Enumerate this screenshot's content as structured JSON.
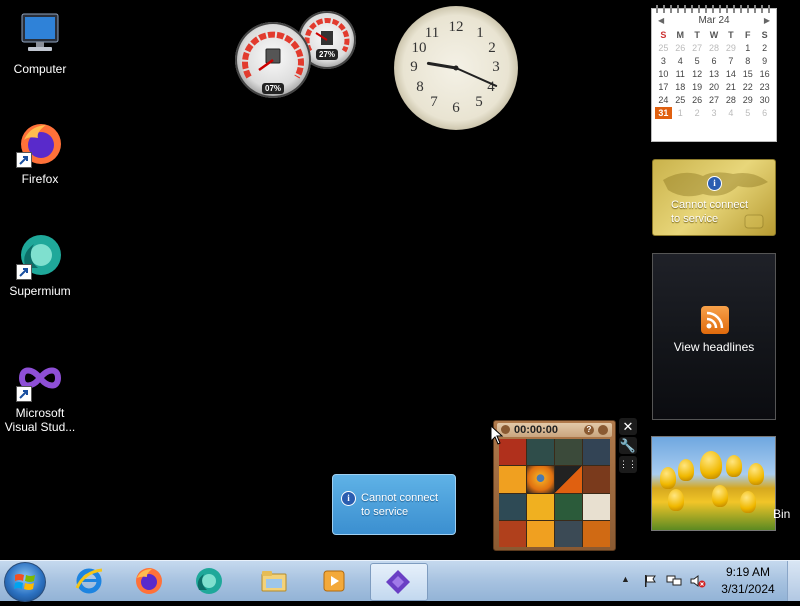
{
  "desktop": {
    "icons": [
      {
        "label": "Computer",
        "icon": "computer-icon"
      },
      {
        "label": "Firefox",
        "icon": "firefox-icon"
      },
      {
        "label": "Supermium",
        "icon": "supermium-icon"
      },
      {
        "label": "Microsoft Visual Stud...",
        "icon": "visual-studio-icon"
      }
    ],
    "recycle_bin_label": "Bin"
  },
  "gadgets": {
    "cpu_meter": {
      "cpu": "07%",
      "memory": "27%"
    },
    "clock": {
      "hour": 9,
      "minute": 19
    },
    "calendar": {
      "month": "Mar 24",
      "day_headers": [
        "S",
        "M",
        "T",
        "W",
        "T",
        "F",
        "S"
      ],
      "weeks": [
        [
          "25",
          "26",
          "27",
          "28",
          "29",
          "1",
          "2"
        ],
        [
          "3",
          "4",
          "5",
          "6",
          "7",
          "8",
          "9"
        ],
        [
          "10",
          "11",
          "12",
          "13",
          "14",
          "15",
          "16"
        ],
        [
          "17",
          "18",
          "19",
          "20",
          "21",
          "22",
          "23"
        ],
        [
          "24",
          "25",
          "26",
          "27",
          "28",
          "29",
          "30"
        ],
        [
          "31",
          "1",
          "2",
          "3",
          "4",
          "5",
          "6"
        ]
      ],
      "today": "31"
    },
    "currency": {
      "message_line1": "Cannot connect",
      "message_line2": "to service"
    },
    "feed_headlines": {
      "label": "View headlines"
    },
    "weather": {
      "message_line1": "Cannot connect",
      "message_line2": "to service"
    },
    "puzzle": {
      "timer": "00:00:00"
    },
    "colors": {
      "accent_orange": "#e06010",
      "weather_blue": "#3b8fd0",
      "currency_gold": "#c9b24b"
    }
  },
  "taskbar": {
    "start": "start-orb",
    "pinned": [
      {
        "name": "internet-explorer",
        "icon": "internet-explorer-icon"
      },
      {
        "name": "firefox",
        "icon": "firefox-icon"
      },
      {
        "name": "supermium",
        "icon": "supermium-icon"
      },
      {
        "name": "windows-explorer",
        "icon": "folder-icon"
      },
      {
        "name": "media-player",
        "icon": "media-player-icon"
      },
      {
        "name": "visual-studio",
        "icon": "visual-studio-icon",
        "active": true
      }
    ],
    "tray": {
      "time": "9:19 AM",
      "date": "3/31/2024"
    }
  }
}
